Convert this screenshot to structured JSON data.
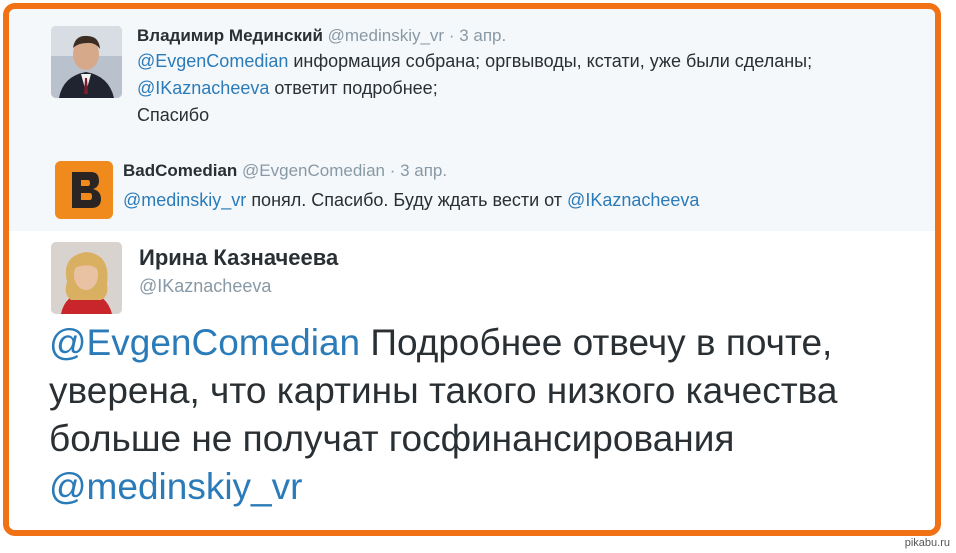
{
  "tweets": {
    "medinsky": {
      "name": "Владимир Мединский",
      "handle": "@medinskiy_vr",
      "sep": " · ",
      "date": "3 апр.",
      "mention1": "@EvgenComedian",
      "text1": "  информация собрана; оргвыводы, кстати, уже были сделаны; ",
      "mention2": "@IKaznacheeva",
      "text2": " ответит подробнее;",
      "text3": "Спасибо"
    },
    "badcomedian": {
      "name": "BadComedian",
      "handle": "@EvgenComedian",
      "sep": " · ",
      "date": "3 апр.",
      "mention1": "@medinskiy_vr",
      "text1": " понял. Спасибо. Буду ждать вести от ",
      "mention2": "@IKaznacheeva"
    },
    "kaznacheeva": {
      "name": "Ирина Казначеева",
      "handle": "@IKaznacheeva",
      "mention1": "@EvgenComedian",
      "text1": " Подробнее отвечу в почте, уверена, что  картины такого низкого качества больше не получат госфинансирования  ",
      "mention2": "@medinskiy_vr"
    }
  },
  "watermark": "pikabu.ru",
  "colors": {
    "frame": "#f07214",
    "mention": "#2b7bb9",
    "text": "#292f33",
    "muted": "#8899a6"
  }
}
